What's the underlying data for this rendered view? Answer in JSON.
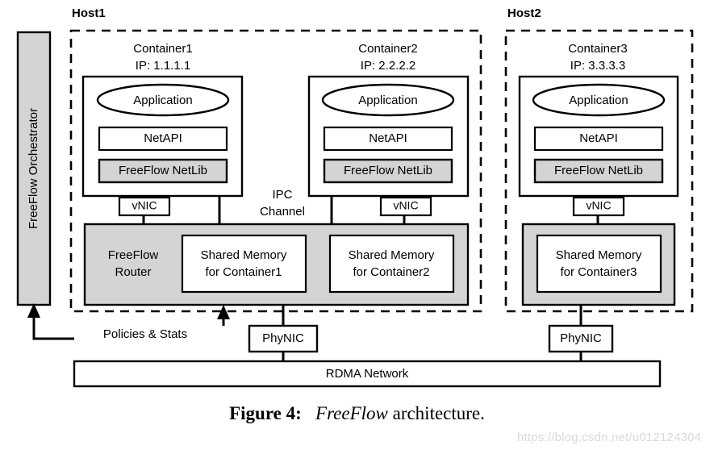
{
  "figure": {
    "caption_number": "Figure 4:",
    "caption_emphasis": "FreeFlow",
    "caption_rest": " architecture.",
    "watermark": "https://blog.csdn.net/u012124304"
  },
  "orchestrator": {
    "label": "FreeFlow Orchestrator",
    "fill": "#d4d4d4"
  },
  "edges": {
    "policies_stats": "Policies & Stats",
    "ipc_channel_line1": "IPC",
    "ipc_channel_line2": "Channel"
  },
  "hosts": [
    {
      "label": "Host1",
      "containers": [
        {
          "name": "Container1",
          "ip": "IP: 1.1.1.1",
          "application": "Application",
          "netapi": "NetAPI",
          "netlib": "FreeFlow NetLib",
          "vnic": "vNIC"
        },
        {
          "name": "Container2",
          "ip": "IP: 2.2.2.2",
          "application": "Application",
          "netapi": "NetAPI",
          "netlib": "FreeFlow NetLib",
          "vnic": "vNIC"
        }
      ],
      "router": {
        "label_line1": "FreeFlow",
        "label_line2": "Router",
        "shared_memories": [
          {
            "line1": "Shared Memory",
            "line2": "for Container1"
          },
          {
            "line1": "Shared Memory",
            "line2": "for Container2"
          }
        ]
      },
      "phynic": "PhyNIC"
    },
    {
      "label": "Host2",
      "containers": [
        {
          "name": "Container3",
          "ip": "IP: 3.3.3.3",
          "application": "Application",
          "netapi": "NetAPI",
          "netlib": "FreeFlow NetLib",
          "vnic": "vNIC"
        }
      ],
      "router": {
        "label_line1": "",
        "label_line2": "",
        "shared_memories": [
          {
            "line1": "Shared Memory",
            "line2": "for Container3"
          }
        ]
      },
      "phynic": "PhyNIC"
    }
  ],
  "network": {
    "label": "RDMA Network"
  },
  "colors": {
    "gray_fill": "#d4d4d4",
    "stroke": "#000000",
    "background": "#ffffff"
  }
}
